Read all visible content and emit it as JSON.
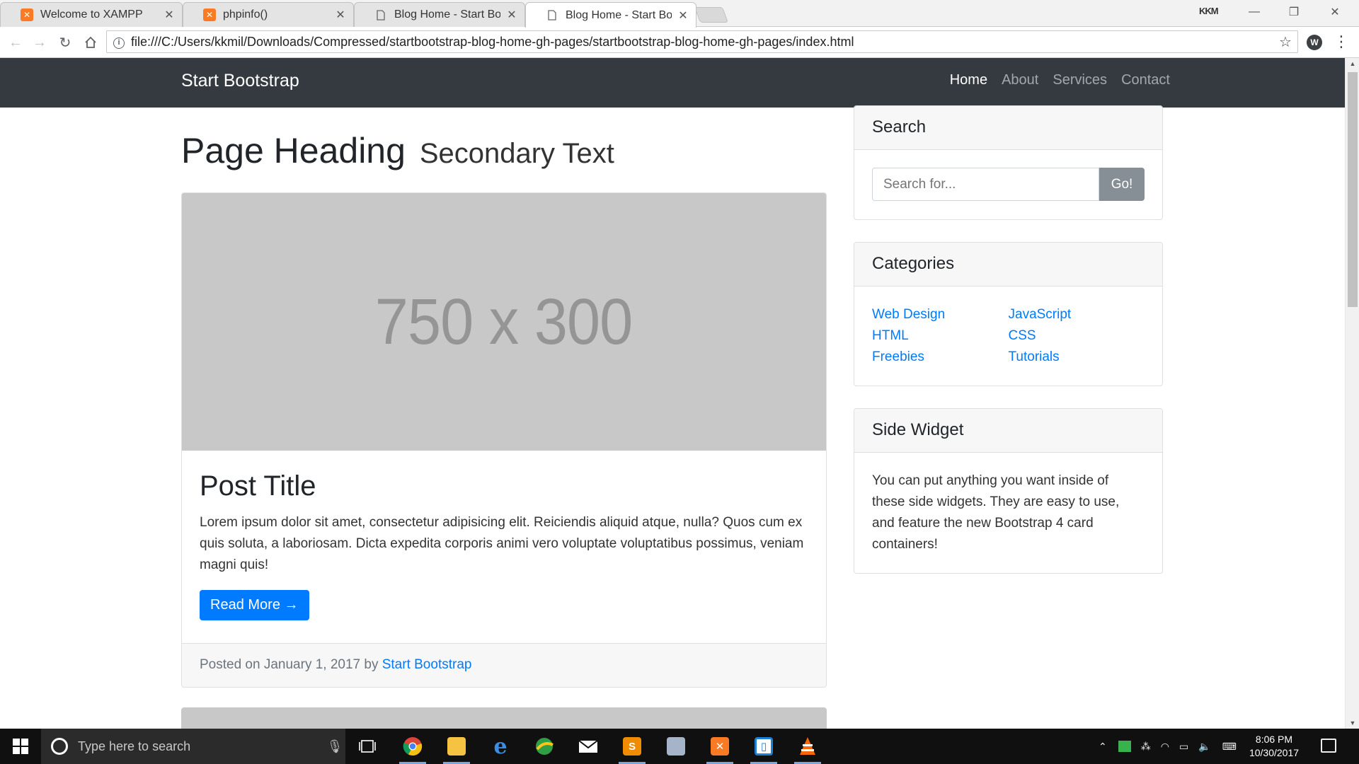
{
  "browser": {
    "tabs": [
      {
        "title": "Welcome to XAMPP",
        "favicon": "xampp-icon"
      },
      {
        "title": "phpinfo()",
        "favicon": "xampp-icon"
      },
      {
        "title": "Blog Home - Start Bootstr",
        "favicon": "page-icon"
      },
      {
        "title": "Blog Home - Start Bootstr",
        "favicon": "page-icon",
        "active": true
      }
    ],
    "profile": "KKM",
    "url": "file:///C:/Users/kkmil/Downloads/Compressed/startbootstrap-blog-home-gh-pages/startbootstrap-blog-home-gh-pages/index.html"
  },
  "site": {
    "brand": "Start Bootstrap",
    "nav": [
      "Home",
      "About",
      "Services",
      "Contact"
    ],
    "active_nav": "Home"
  },
  "main": {
    "heading": "Page Heading",
    "heading_secondary": "Secondary Text",
    "post": {
      "image_placeholder": "750 x 300",
      "title": "Post Title",
      "text": "Lorem ipsum dolor sit amet, consectetur adipisicing elit. Reiciendis aliquid atque, nulla? Quos cum ex quis soluta, a laboriosam. Dicta expedita corporis animi vero voluptate voluptatibus possimus, veniam magni quis!",
      "read_more": "Read More →",
      "footer_prefix": "Posted on January 1, 2017 by",
      "author": "Start Bootstrap"
    }
  },
  "sidebar": {
    "search": {
      "title": "Search",
      "placeholder": "Search for...",
      "button": "Go!"
    },
    "categories": {
      "title": "Categories",
      "col1": [
        "Web Design",
        "HTML",
        "Freebies"
      ],
      "col2": [
        "JavaScript",
        "CSS",
        "Tutorials"
      ]
    },
    "side_widget": {
      "title": "Side Widget",
      "text": "You can put anything you want inside of these side widgets. They are easy to use, and feature the new Bootstrap 4 card containers!"
    }
  },
  "taskbar": {
    "search_placeholder": "Type here to search",
    "time": "8:06 PM",
    "date": "10/30/2017"
  },
  "colors": {
    "navbar": "#343a40",
    "primary": "#007bff",
    "secondary_button": "#868e96",
    "placeholder_image": "#c8c8c8"
  }
}
